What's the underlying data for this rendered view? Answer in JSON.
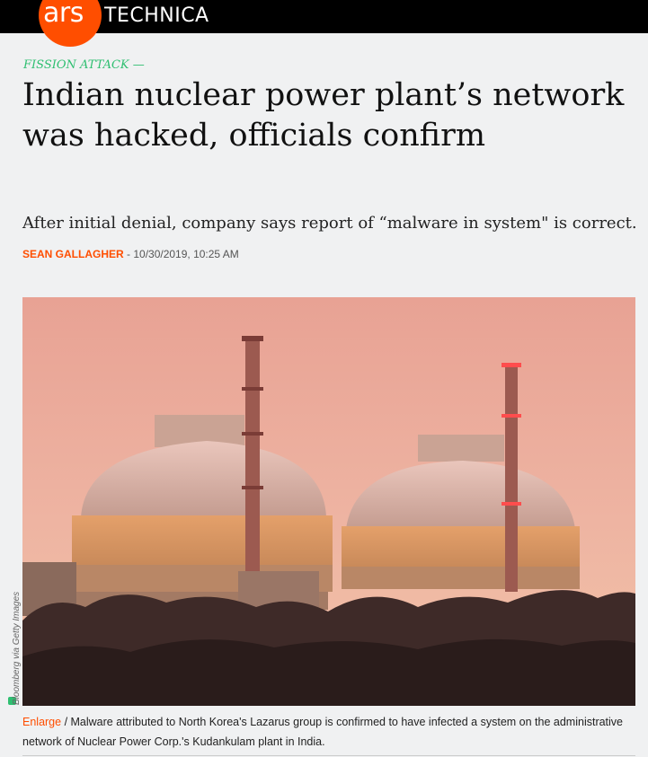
{
  "site": {
    "logo_ars": "ars",
    "logo_technica": "TECHNICA",
    "colors": {
      "accent": "#ff4e00",
      "kicker": "#2fbf71",
      "bar": "#000000"
    }
  },
  "article": {
    "kicker": "FISSION ATTACK —",
    "headline": "Indian nuclear power plant’s network was hacked, officials confirm",
    "dek": "After initial denial, company says report of “malware in system\" is correct.",
    "author": "SEAN GALLAGHER",
    "date_separator": " - ",
    "date": "10/30/2019, 10:25 AM"
  },
  "image": {
    "credit": "Bloomberg via Getty Images",
    "enlarge_label": "Enlarge",
    "caption": " / Malware attributed to North Korea's Lazarus group is confirmed to have infected a system on the administrative network of Nuclear Power Corp.'s Kudankulam plant in India."
  }
}
